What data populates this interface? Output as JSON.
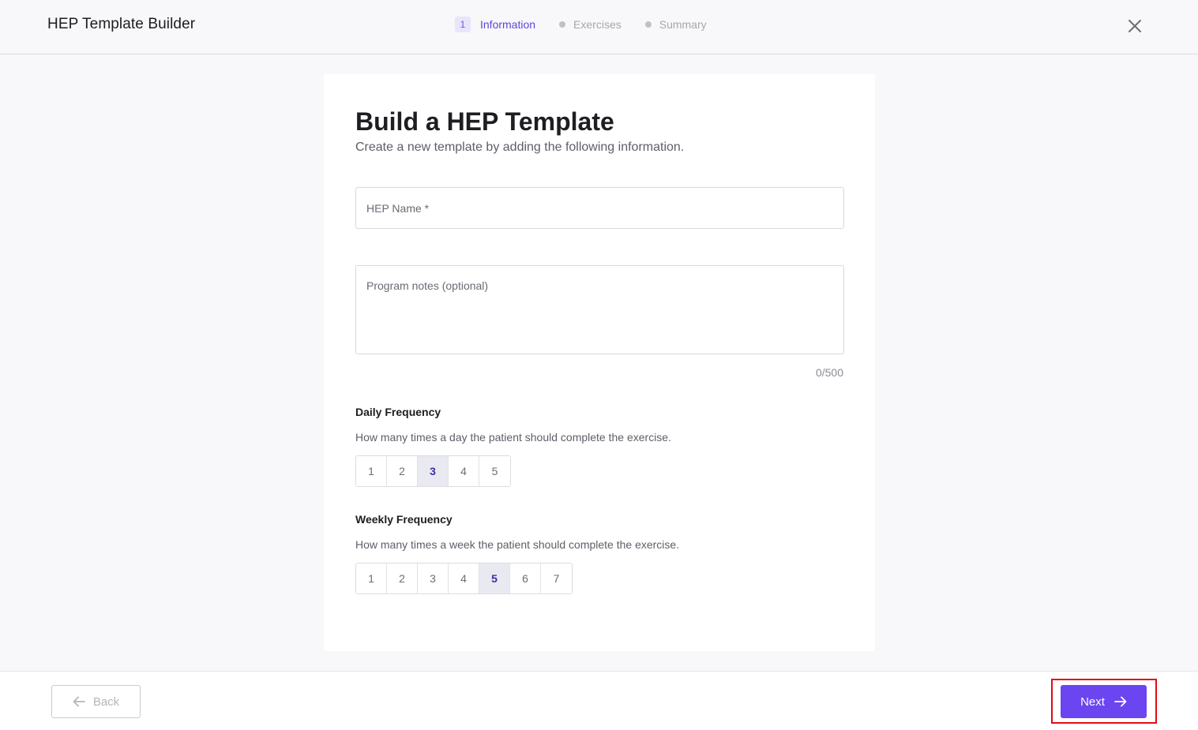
{
  "header": {
    "app_title": "HEP Template Builder",
    "steps": [
      {
        "number": "1",
        "label": "Information",
        "state": "active"
      },
      {
        "label": "Exercises",
        "state": "inactive"
      },
      {
        "label": "Summary",
        "state": "inactive"
      }
    ],
    "close_icon": "close-icon"
  },
  "form": {
    "title": "Build a HEP Template",
    "subtitle": "Create a new template by adding the following information.",
    "hep_name": {
      "value": "",
      "placeholder": "HEP Name *"
    },
    "program_notes": {
      "value": "",
      "placeholder": "Program notes (optional)",
      "char_count": "0/500"
    },
    "daily_frequency": {
      "title": "Daily Frequency",
      "description": "How many times a day the patient should complete the exercise.",
      "options": [
        "1",
        "2",
        "3",
        "4",
        "5"
      ],
      "selected": "3"
    },
    "weekly_frequency": {
      "title": "Weekly Frequency",
      "description": "How many times a week the patient should complete the exercise.",
      "options": [
        "1",
        "2",
        "3",
        "4",
        "5",
        "6",
        "7"
      ],
      "selected": "5"
    }
  },
  "footer": {
    "back_label": "Back",
    "back_icon": "arrow-left-icon",
    "next_label": "Next",
    "next_icon": "arrow-right-icon"
  },
  "colors": {
    "accent": "#6b45f0",
    "step_active": "#5b47d6",
    "highlight": "#e10a18",
    "selected_bg": "#e9e9f1"
  }
}
